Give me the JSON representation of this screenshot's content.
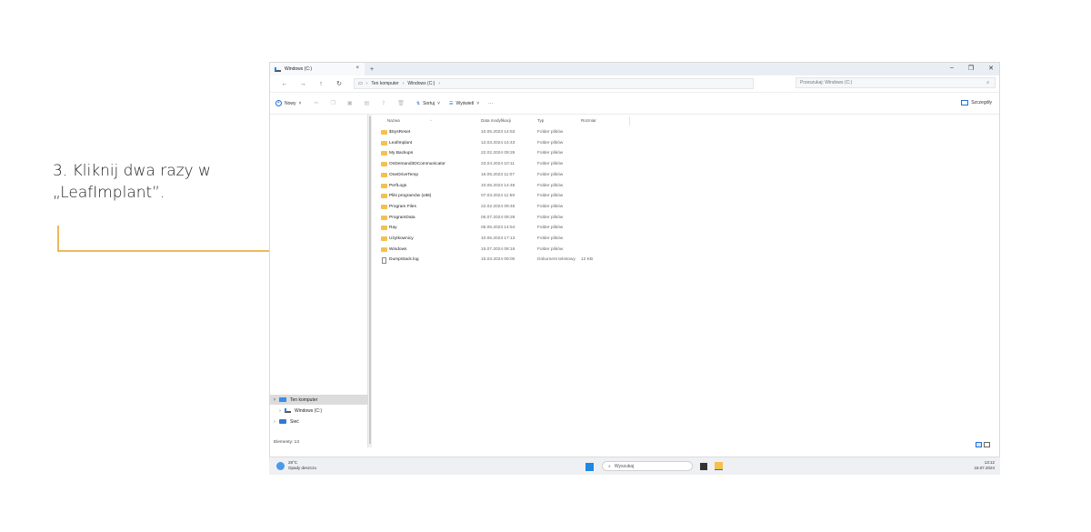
{
  "instruction": {
    "line1": "3. Kliknij dwa razy w",
    "line2": "„LeafImplant”."
  },
  "window": {
    "tab_title": "Windows (C:)",
    "tab_close": "×",
    "tab_add": "+",
    "controls": [
      "–",
      "❐",
      "✕"
    ]
  },
  "address": {
    "back": "←",
    "forward": "→",
    "up": "↑",
    "refresh": "↻",
    "crumbs": [
      "Ten komputer",
      "Windows (C:)"
    ],
    "search_placeholder": "Przeszukaj: Windows (C:)"
  },
  "toolbar": {
    "new_label": "Nowy",
    "sort_label": "Sortuj",
    "view_label": "Wyświetl",
    "more_label": "···",
    "details_label": "Szczegóły"
  },
  "columns": {
    "name": "Nazwa",
    "date": "Data modyfikacji",
    "type": "Typ",
    "size": "Rozmiar"
  },
  "files": [
    {
      "name": "$SysReset",
      "date": "10.05.2023 14:53",
      "type": "Folder plików",
      "size": "",
      "kind": "folder"
    },
    {
      "name": "LeafImplant",
      "date": "12.03.2024 14:43",
      "type": "Folder plików",
      "size": "",
      "kind": "folder"
    },
    {
      "name": "My Backups",
      "date": "22.02.2024 09:26",
      "type": "Folder plików",
      "size": "",
      "kind": "folder"
    },
    {
      "name": "OnDemand3DCommunicator",
      "date": "23.04.2024 10:11",
      "type": "Folder plików",
      "size": "",
      "kind": "folder"
    },
    {
      "name": "OneDriveTemp",
      "date": "16.05.2023 11:07",
      "type": "Folder plików",
      "size": "",
      "kind": "folder"
    },
    {
      "name": "PerfLogs",
      "date": "10.05.2023 14:48",
      "type": "Folder plików",
      "size": "",
      "kind": "folder"
    },
    {
      "name": "Pliki programów (x86)",
      "date": "07.03.2024 11:59",
      "type": "Folder plików",
      "size": "",
      "kind": "folder"
    },
    {
      "name": "Program Files",
      "date": "22.02.2024 09:45",
      "type": "Folder plików",
      "size": "",
      "kind": "folder"
    },
    {
      "name": "ProgramData",
      "date": "05.07.2024 09:28",
      "type": "Folder plików",
      "size": "",
      "kind": "folder"
    },
    {
      "name": "Ray",
      "date": "05.06.2023 14:54",
      "type": "Folder plików",
      "size": "",
      "kind": "folder"
    },
    {
      "name": "Użytkownicy",
      "date": "10.05.2023 17:13",
      "type": "Folder plików",
      "size": "",
      "kind": "folder"
    },
    {
      "name": "Windows",
      "date": "15.07.2024 08:16",
      "type": "Folder plików",
      "size": "",
      "kind": "folder"
    },
    {
      "name": "DumpStack.log",
      "date": "15.03.2024 09:00",
      "type": "Dokument tekstowy",
      "size": "12 KB",
      "kind": "file"
    }
  ],
  "navpane": {
    "this_pc": "Ten komputer",
    "drive": "Windows (C:)",
    "network": "Sieć"
  },
  "status": {
    "items": "Elementy: 13"
  },
  "taskbar": {
    "temp": "28°C",
    "weather": "Opady deszczu",
    "search": "Wyszukaj",
    "time": "13:12",
    "date": "18.07.2024"
  },
  "colors": {
    "accent": "#e8a224",
    "folder": "#f2c14e",
    "blue": "#1e6fd9"
  }
}
